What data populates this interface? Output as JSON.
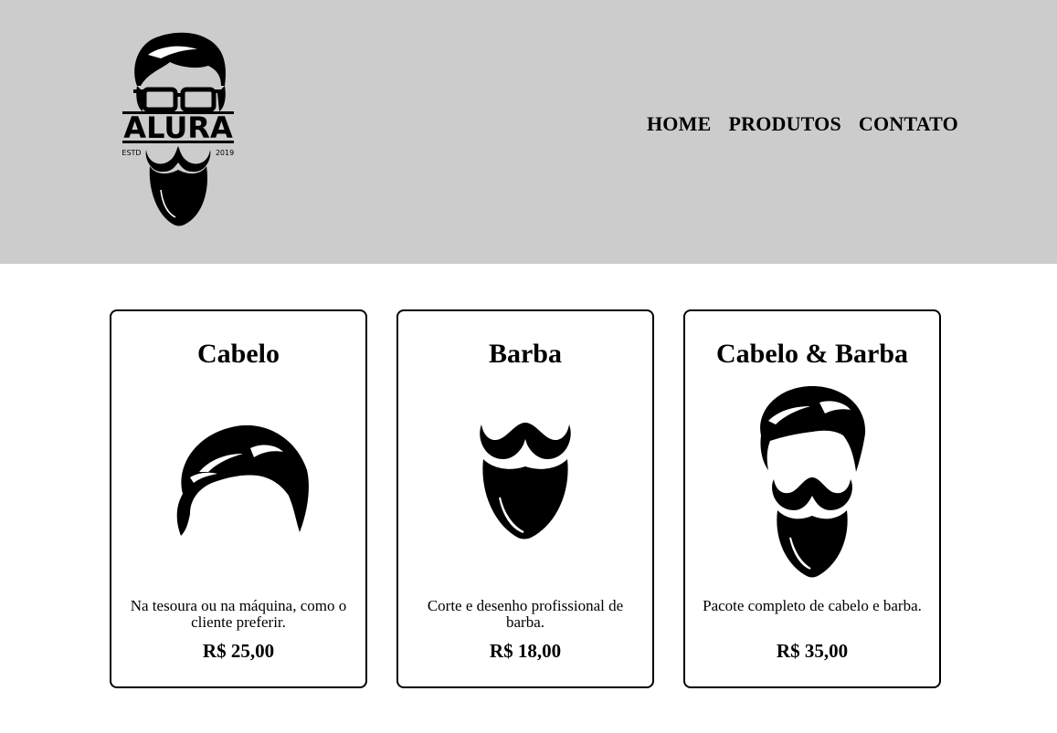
{
  "header": {
    "logo": {
      "text": "ALURA",
      "left_caption": "ESTD",
      "right_caption": "2019",
      "icon": "bearded-man-with-glasses-logo"
    },
    "nav": [
      {
        "label": "HOME"
      },
      {
        "label": "PRODUTOS"
      },
      {
        "label": "CONTATO"
      }
    ]
  },
  "products": [
    {
      "title": "Cabelo",
      "icon": "hair-icon",
      "description": "Na tesoura ou na máquina, como o cliente preferir.",
      "price": "R$ 25,00"
    },
    {
      "title": "Barba",
      "icon": "beard-icon",
      "description": "Corte e desenho profissional de barba.",
      "price": "R$ 18,00"
    },
    {
      "title": "Cabelo & Barba",
      "icon": "hair-and-beard-icon",
      "description": "Pacote completo de cabelo e barba.",
      "price": "R$ 35,00"
    }
  ]
}
